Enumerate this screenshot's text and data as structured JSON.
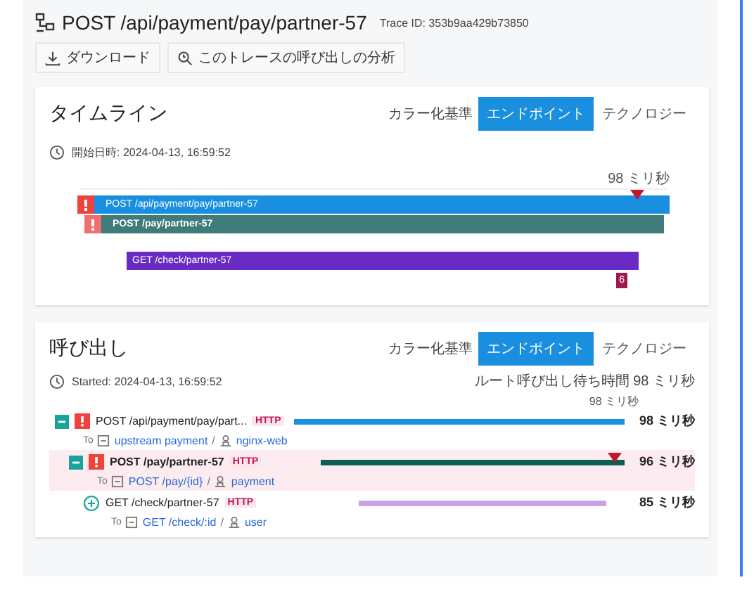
{
  "header": {
    "title": "POST /api/payment/pay/partner-57",
    "trace_id": "Trace ID: 353b9aa429b73850"
  },
  "toolbar": [
    {
      "kind": "download",
      "label": "ダウンロード"
    },
    {
      "kind": "analyze",
      "label": "このトレースの呼び出しの分析"
    }
  ],
  "timeline": {
    "title": "タイムライン",
    "color_by": "カラー化基準",
    "options": [
      {
        "label": "エンドポイント",
        "selected": true
      },
      {
        "label": "テクノロジー",
        "selected": false
      }
    ],
    "started": "開始日時: 2024-04-13, 16:59:52",
    "scale_end": "98 ミリ秒",
    "bars": [
      {
        "kind": "root",
        "label": "POST /api/payment/pay/partner-57",
        "color": "#1a8fe0",
        "error": true,
        "marker": true
      },
      {
        "kind": "child",
        "label": "POST /pay/partner-57",
        "color": "#3f7b78",
        "error": true,
        "marker": false
      },
      {
        "kind": "grandchild",
        "label": "GET /check/partner-57",
        "color": "#6a2bc4",
        "error": false,
        "marker": false
      }
    ],
    "badge": "6"
  },
  "calls": {
    "title": "呼び出し",
    "color_by": "カラー化基準",
    "options": [
      {
        "label": "エンドポイント",
        "selected": true
      },
      {
        "label": "テクノロジー",
        "selected": false
      }
    ],
    "started": "Started: 2024-04-13, 16:59:52",
    "root_wait": "ルート呼び出し待ち時間 98 ミリ秒",
    "scale_end": "98 ミリ秒",
    "rows": [
      {
        "expanded": true,
        "error": true,
        "highlighted": false,
        "name": "POST /api/payment/pay/part...",
        "protocol": "HTTP",
        "color": "#1a8fe0",
        "duration": "98 ミリ秒",
        "to": "To",
        "target": "upstream payment",
        "separator": "/",
        "service": "nginx-web",
        "marker": false,
        "children": [
          {
            "expanded": true,
            "error": true,
            "highlighted": true,
            "name": "POST /pay/partner-57",
            "protocol": "HTTP",
            "color": "#0f5e55",
            "duration": "96 ミリ秒",
            "to": "To",
            "target": "POST /pay/{id}",
            "separator": "/",
            "service": "payment",
            "marker": true,
            "children": [
              {
                "expanded": false,
                "error": false,
                "highlighted": false,
                "name": "GET /check/partner-57",
                "protocol": "HTTP",
                "color": "#c9a3e8",
                "duration": "85 ミリ秒",
                "to": "To",
                "target": "GET /check/:id",
                "separator": "/",
                "service": "user",
                "marker": false
              }
            ]
          }
        ]
      }
    ]
  }
}
